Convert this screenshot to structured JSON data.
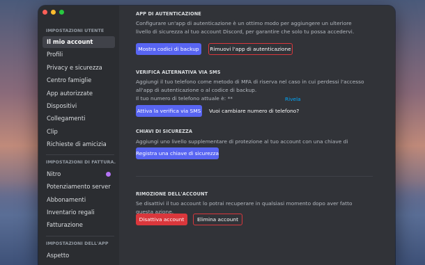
{
  "sidebar": {
    "user_settings_title": "IMPOSTAZIONI UTENTE",
    "user_items": [
      {
        "label": "Il mio account"
      },
      {
        "label": "Profili"
      },
      {
        "label": "Privacy e sicurezza"
      },
      {
        "label": "Centro famiglie"
      },
      {
        "label": "App autorizzate"
      },
      {
        "label": "Dispositivi"
      },
      {
        "label": "Collegamenti"
      },
      {
        "label": "Clip"
      },
      {
        "label": "Richieste di amicizia"
      }
    ],
    "billing_title": "IMPOSTAZIONI DI FATTURA...",
    "billing_items": [
      {
        "label": "Nitro"
      },
      {
        "label": "Potenziamento server"
      },
      {
        "label": "Abbonamenti"
      },
      {
        "label": "Inventario regali"
      },
      {
        "label": "Fatturazione"
      }
    ],
    "app_title": "IMPOSTAZIONI DELL'APP",
    "app_items": [
      {
        "label": "Aspetto"
      }
    ]
  },
  "auth_app": {
    "title": "APP DI AUTENTICAZIONE",
    "description": "Configurare un'app di autenticazione è un ottimo modo per aggiungere un ulteriore livello di sicurezza al tuo account Discord, per garantire che solo tu possa accedervi.",
    "backup_codes_button": "Mostra codici di backup",
    "remove_app_button": "Rimuovi l'app di autenticazione"
  },
  "sms": {
    "title": "VERIFICA ALTERNATIVA VIA SMS",
    "description": "Aggiungi il tuo telefono come metodo di MFA di riserva nel caso in cui perdessi l'accesso all'app di autenticazione o al codice di backup.",
    "phone_label": "Il tuo numero di telefono attuale è: **",
    "reveal_link": "Rivela",
    "enable_button": "Attiva la verifica via SMS",
    "change_number_link": "Vuoi cambiare numero di telefono?"
  },
  "security_keys": {
    "title": "CHIAVI DI SICUREZZA",
    "description": "Aggiungi uno livello supplementare di protezione al tuo account con una chiave di sicurezza.",
    "register_button": "Registra una chiave di sicurezza"
  },
  "removal": {
    "title": "RIMOZIONE DELL'ACCOUNT",
    "description": "Se disattivi il tuo account lo potrai recuperare in qualsiasi momento dopo aver fatto questa azione.",
    "disable_button": "Disattiva account",
    "delete_button": "Elimina account"
  },
  "colors": {
    "accent": "#5865f2",
    "danger": "#da373c",
    "link": "#00a8fc",
    "background": "#313338",
    "sidebar": "#2b2d31"
  }
}
